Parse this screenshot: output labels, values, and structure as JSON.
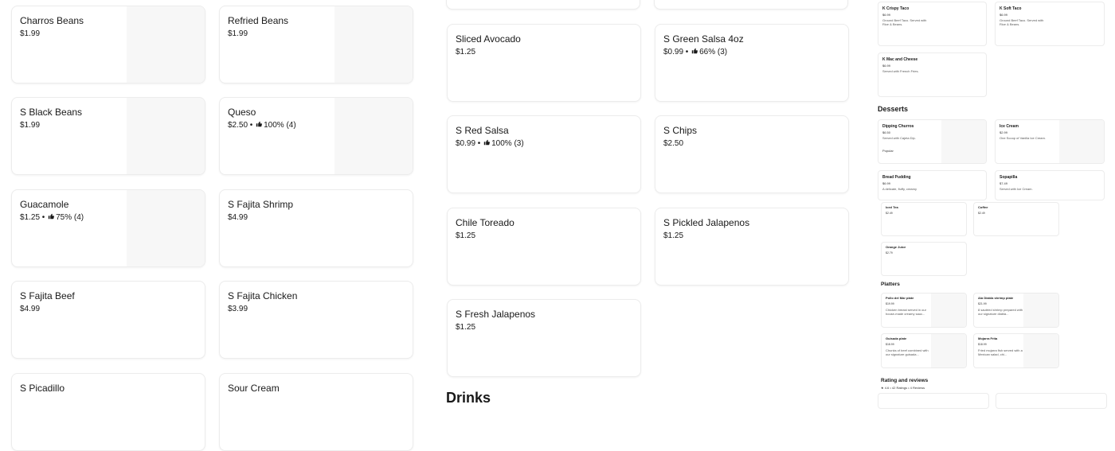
{
  "col1": [
    {
      "name": "Charros Beans",
      "price": "$1.99"
    },
    {
      "name": "Refried Beans",
      "price": "$1.99"
    },
    {
      "name": "S Black Beans",
      "price": "$1.99"
    },
    {
      "name": "Queso",
      "price": "$2.50",
      "rating": "100% (4)"
    },
    {
      "name": "Guacamole",
      "price": "$1.25",
      "rating": "75% (4)"
    },
    {
      "name": "S Fajita Shrimp",
      "price": "$4.99"
    },
    {
      "name": "S Fajita Beef",
      "price": "$4.99"
    },
    {
      "name": "S Fajita Chicken",
      "price": "$3.99"
    },
    {
      "name": "S Picadillo",
      "price": ""
    },
    {
      "name": "Sour Cream",
      "price": ""
    }
  ],
  "col2": [
    {
      "name": "Sliced Avocado",
      "price": "$1.25"
    },
    {
      "name": "S Green Salsa 4oz",
      "price": "$0.99",
      "rating": "66% (3)"
    },
    {
      "name": "S Red Salsa",
      "price": "$0.99",
      "rating": "100% (3)"
    },
    {
      "name": "S Chips",
      "price": "$2.50"
    },
    {
      "name": "Chile Toreado",
      "price": "$1.25"
    },
    {
      "name": "S Pickled Jalapenos",
      "price": "$1.25"
    },
    {
      "name": "S Fresh Jalapenos",
      "price": "$1.25"
    }
  ],
  "drinks_heading": "Drinks",
  "thumb": {
    "kids": [
      {
        "name": "K Crispy Taco",
        "price": "$6.99",
        "desc": "Ground Beef Taco. Served with Rice & Beans."
      },
      {
        "name": "K Soft Taco",
        "price": "$6.99",
        "desc": "Ground Beef Taco. Served with Rice & Beans."
      },
      {
        "name": "K Mac and Cheese",
        "price": "$6.99",
        "desc": "Served with French Fries."
      }
    ],
    "desserts_heading": "Desserts",
    "desserts": [
      {
        "name": "Dipping Churros",
        "price": "$6.50",
        "desc": "Served with Cajeta Dip.",
        "badge": "Popular"
      },
      {
        "name": "Ice Cream",
        "price": "$2.99",
        "desc": "One Scoop of Vanilla Ice Cream."
      },
      {
        "name": "Bread Pudding",
        "price": "$6.99",
        "desc": "A delicate, fluffy, creamy"
      },
      {
        "name": "Sopapilla",
        "price": "$7.49",
        "desc": "Served with Ice Cream."
      }
    ],
    "drinks": [
      {
        "name": "Iced Tea",
        "price": "$2.49"
      },
      {
        "name": "Coffee",
        "price": "$2.49"
      },
      {
        "name": "Orange Juice",
        "price": "$2.79"
      }
    ],
    "platters_heading": "Platters",
    "platters": [
      {
        "name": "Pollo del Mar plate",
        "price": "$19.99",
        "desc": "Chicken breast served in our house-made creamy sauc..."
      },
      {
        "name": "Ala Diabla shrimp plate",
        "price": "$21.99",
        "desc": "8 sautéed shrimp prepared with our signature diabla..."
      },
      {
        "name": "Guisada plate",
        "price": "$18.99",
        "desc": "Chunks of beef combined with our signature guisada..."
      },
      {
        "name": "Mojarra Frita",
        "price": "$18.99",
        "desc": "Fried mojarra fish served with a Mexican salad, chi..."
      }
    ],
    "reviews_heading": "Rating and reviews",
    "reviews_summary": "★ 4.6 • 42 Ratings • 4 Reviews"
  },
  "colors": {
    "text": "#191919",
    "border": "#ececec",
    "placeholder": "#f7f7f7",
    "popular": "#137c3b"
  }
}
